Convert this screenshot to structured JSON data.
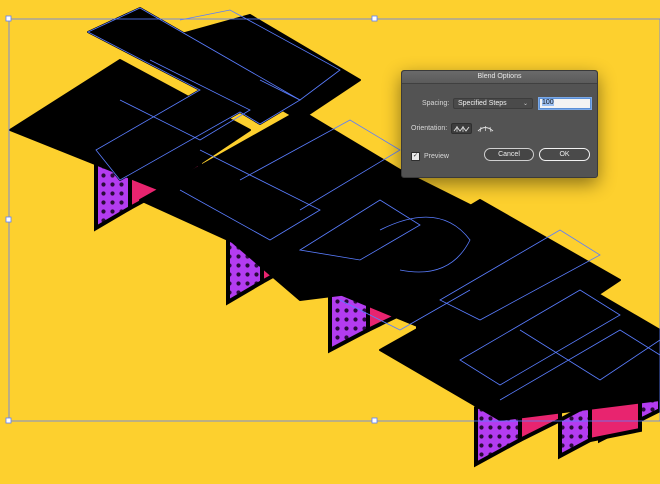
{
  "artwork": {
    "colors": {
      "background": "#fdd02e",
      "face": "#000000",
      "side_pink": "#e8246f",
      "side_purple": "#b33cf0",
      "dot": "#2a0a3a",
      "outline": "#5a7dff"
    }
  },
  "dialog": {
    "title": "Blend Options",
    "spacing_label": "Spacing:",
    "spacing_value": "Specified Steps",
    "steps_value": "100",
    "orientation_label": "Orientation:",
    "orientation_icons": [
      "align-to-page-icon",
      "align-to-path-icon"
    ],
    "preview_label": "Preview",
    "preview_checked": true,
    "cancel_label": "Cancel",
    "ok_label": "OK"
  }
}
